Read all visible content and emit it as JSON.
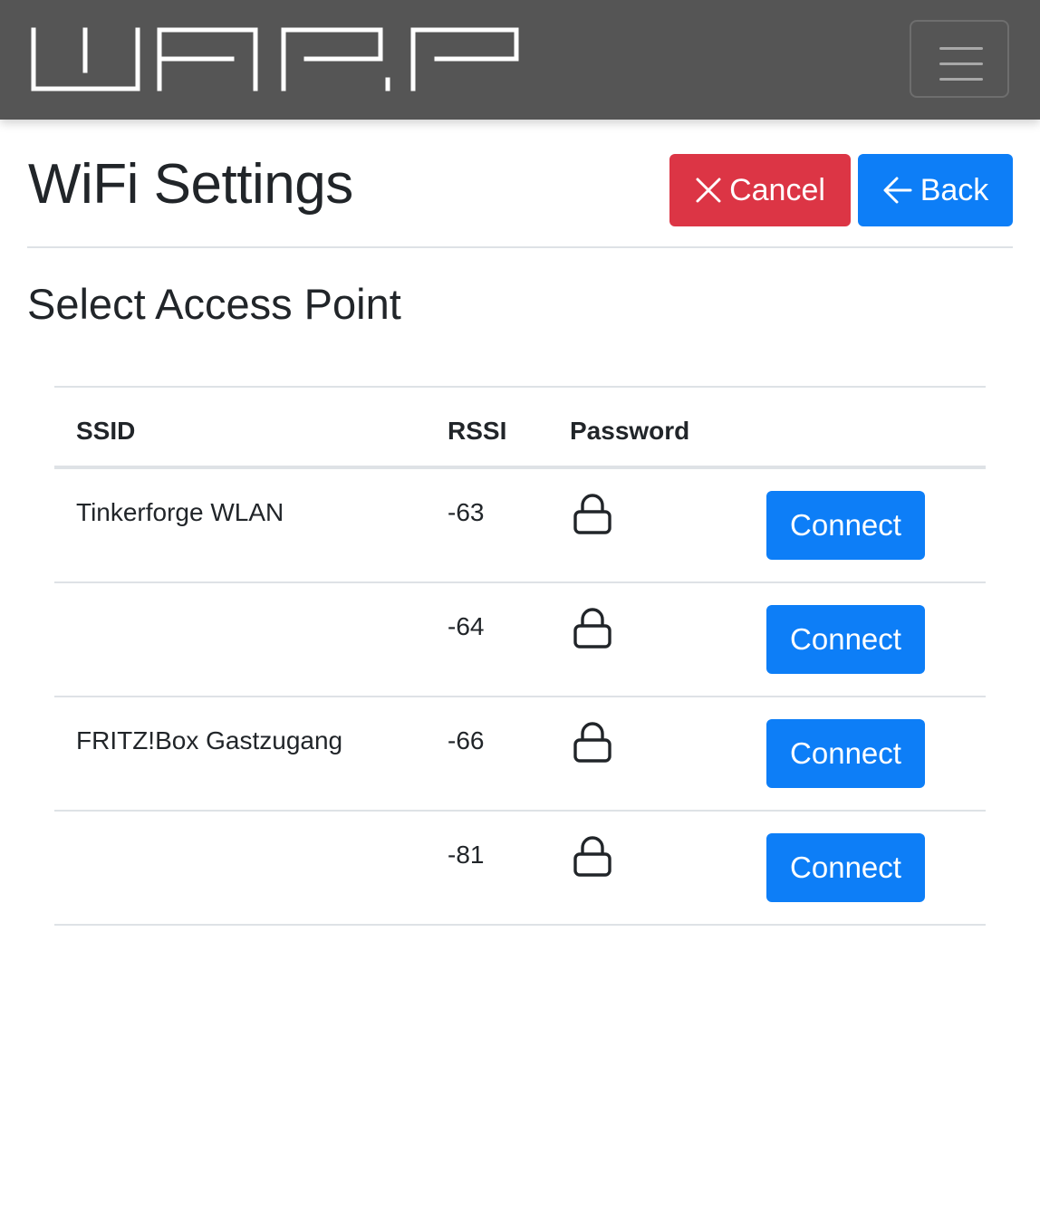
{
  "navbar": {
    "logo_text": "WARP",
    "menu_icon": "hamburger-menu-icon"
  },
  "header": {
    "title": "WiFi Settings",
    "cancel_label": "Cancel",
    "cancel_icon": "close-icon",
    "back_label": "Back",
    "back_icon": "arrow-left-icon"
  },
  "section": {
    "title": "Select Access Point"
  },
  "table": {
    "columns": [
      "SSID",
      "RSSI",
      "Password",
      ""
    ],
    "rows": [
      {
        "ssid": "Tinkerforge WLAN",
        "rssi": "-63",
        "password_icon": "lock-icon",
        "action": "Connect"
      },
      {
        "ssid": "",
        "rssi": "-64",
        "password_icon": "lock-icon",
        "action": "Connect"
      },
      {
        "ssid": "FRITZ!Box Gastzugang",
        "rssi": "-66",
        "password_icon": "lock-icon",
        "action": "Connect"
      },
      {
        "ssid": "",
        "rssi": "-81",
        "password_icon": "lock-icon",
        "action": "Connect"
      }
    ]
  },
  "colors": {
    "navbar_bg": "#555555",
    "danger": "#dc3545",
    "primary": "#0d7ef7",
    "border": "#dee2e6"
  }
}
